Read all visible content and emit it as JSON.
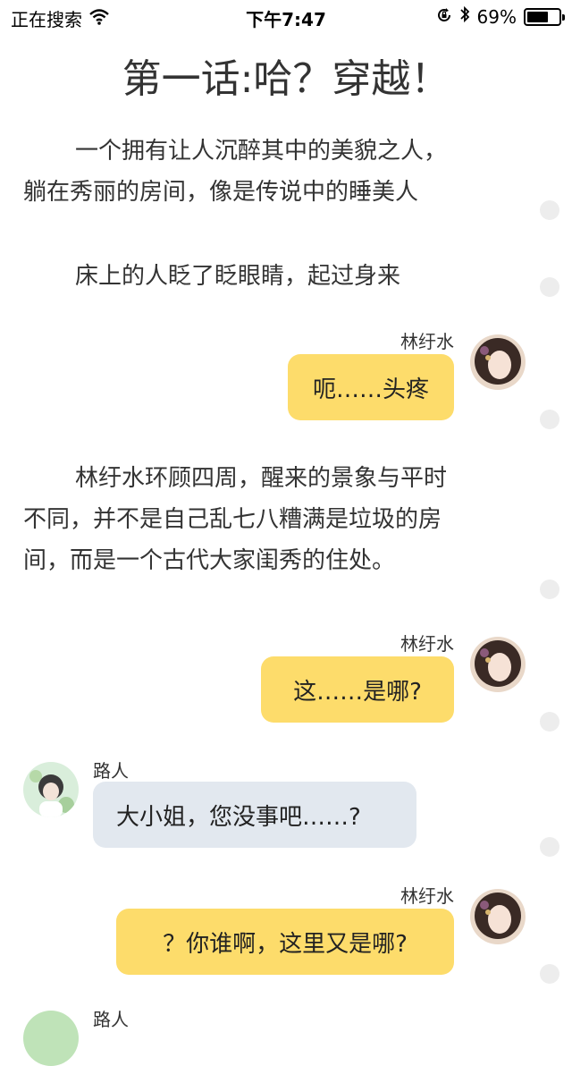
{
  "status_bar": {
    "carrier": "正在搜索",
    "time": "下午7:47",
    "battery": "69%",
    "battery_level": 0.69
  },
  "chapter": {
    "title": "第一话:哈？穿越！"
  },
  "story": {
    "p1": [
      "一个拥有让人沉醉其中的美貌之人，",
      "躺在秀丽的房间，像是传说中的睡美人"
    ],
    "p2": "床上的人眨了眨眼睛，起过身来",
    "p3": [
      "林纡水环顾四周，醒来的景象与平时",
      "不同，并不是自己乱七八糟满是垃圾的房",
      "间，而是一个古代大家闺秀的住处。"
    ]
  },
  "messages": [
    {
      "speaker": "林纡水",
      "text": "呃……头疼",
      "side": "right"
    },
    {
      "speaker": "林纡水",
      "text": "这……是哪?",
      "side": "right"
    },
    {
      "speaker": "路人",
      "text": "大小姐，您没事吧……?",
      "side": "left"
    },
    {
      "speaker": "林纡水",
      "text": "？你谁啊，这里又是哪?",
      "side": "right"
    },
    {
      "speaker": "路人",
      "text": "",
      "side": "left"
    }
  ],
  "colors": {
    "bubble_right": "#fddc6b",
    "bubble_left": "#e2e8ef"
  },
  "icons": [
    "wifi-icon",
    "lock-rotation-icon",
    "bluetooth-icon",
    "battery-icon",
    "avatar-linyushui",
    "avatar-passerby",
    "scroll-dot"
  ]
}
